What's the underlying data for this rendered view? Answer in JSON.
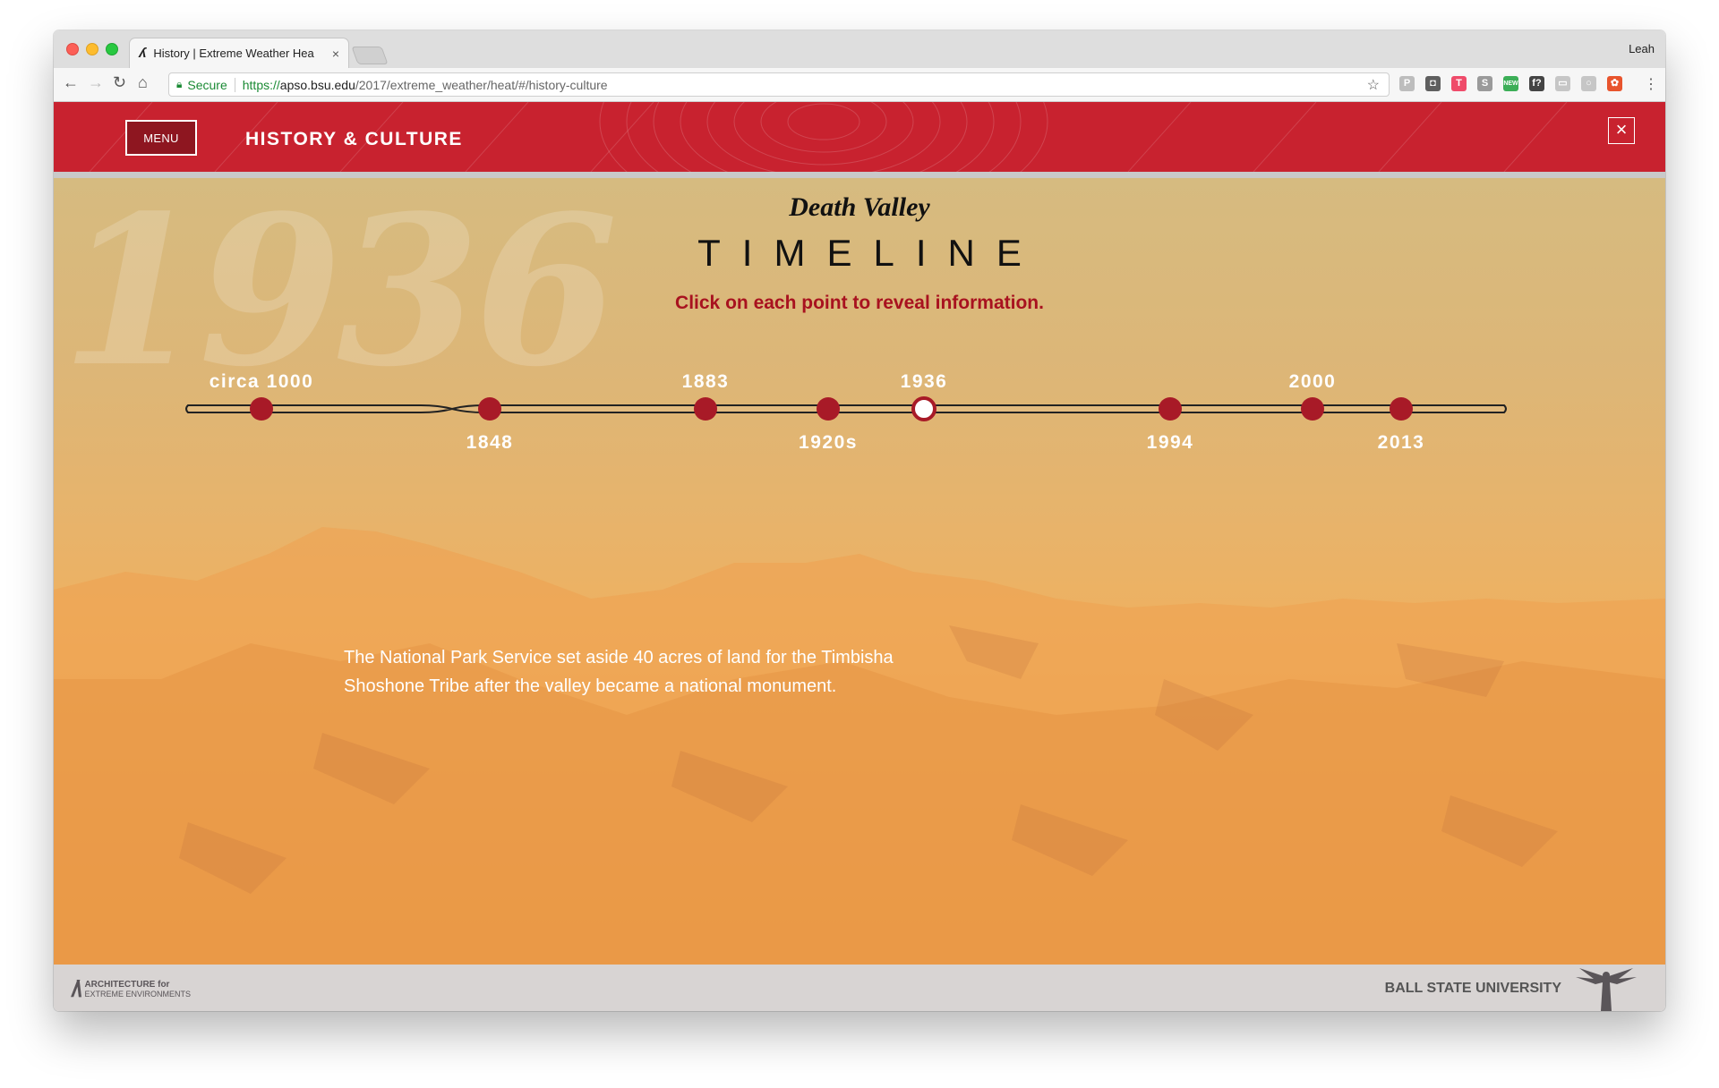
{
  "browser": {
    "tab_title": "History | Extreme Weather Hea",
    "tab_close": "×",
    "tab_favicon": "ʎ",
    "profile_name": "Leah",
    "secure_label": "Secure",
    "url_protocol": "https://",
    "url_host": "apso.bsu.edu",
    "url_path": "/2017/extreme_weather/heat/#/history-culture",
    "extensions": [
      {
        "name": "p-ext-icon",
        "label": "P",
        "color": "#bdbdbd"
      },
      {
        "name": "clipper-icon",
        "label": "◘",
        "color": "#5f5f5f"
      },
      {
        "name": "t-ext-icon",
        "label": "T",
        "color": "#ef4b6a"
      },
      {
        "name": "s-ext-icon",
        "label": "S",
        "color": "#9a9a9a"
      },
      {
        "name": "new-badge-icon",
        "label": "NEW",
        "color": "#3cae57"
      },
      {
        "name": "fquestion-icon",
        "label": "f?",
        "color": "#444444"
      },
      {
        "name": "square-ext-icon",
        "label": "▭",
        "color": "#c6c6c6"
      },
      {
        "name": "circle-ext-icon",
        "label": "○",
        "color": "#c6c6c6"
      },
      {
        "name": "color-picker-icon",
        "label": "✿",
        "color": "#e8542d"
      }
    ]
  },
  "header": {
    "menu_label": "MENU",
    "section_title": "HISTORY & CULTURE",
    "close_label": "×"
  },
  "main": {
    "ghost_year": "1936",
    "subtitle": "Death Valley",
    "title": "TIMELINE",
    "instruction": "Click on each point to reveal information.",
    "event_text": "The National Park Service set aside 40 acres of land for the Timbisha Shoshone Tribe after the valley became a national monument."
  },
  "timeline": {
    "points": [
      {
        "label": "circa 1000",
        "position": "above",
        "selected": false
      },
      {
        "label": "1848",
        "position": "below",
        "selected": false
      },
      {
        "label": "1883",
        "position": "above",
        "selected": false
      },
      {
        "label": "1920s",
        "position": "below",
        "selected": false
      },
      {
        "label": "1936",
        "position": "above",
        "selected": true
      },
      {
        "label": "1994",
        "position": "below",
        "selected": false
      },
      {
        "label": "2000",
        "position": "above",
        "selected": false
      },
      {
        "label": "2013",
        "position": "below",
        "selected": false
      }
    ]
  },
  "footer": {
    "ax_line1": "ARCHITECTURE for",
    "ax_line2": "EXTREME ENVIRONMENTS",
    "university": "BALL STATE UNIVERSITY"
  },
  "colors": {
    "brand_red": "#c8222f",
    "point_red": "#a81a27",
    "instruction_red": "#a8121f"
  }
}
